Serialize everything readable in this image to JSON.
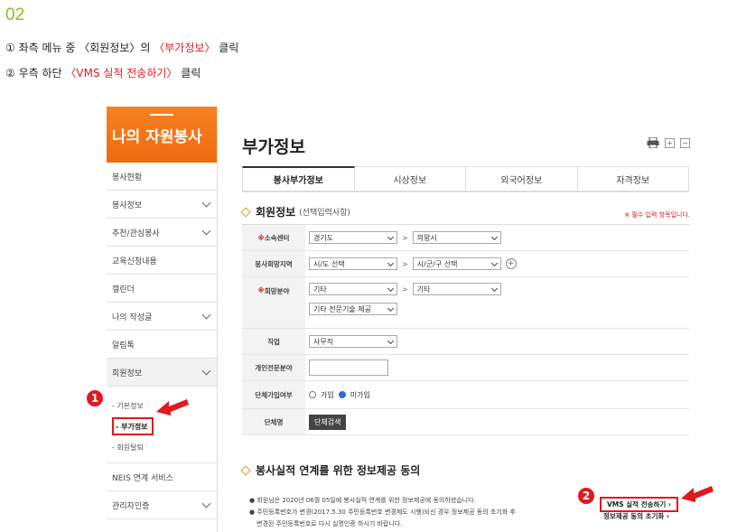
{
  "step": "02",
  "instructions": {
    "line1_pre": "① 좌측 메뉴 중 〈회원정보〉의 ",
    "line1_red": "〈부가정보〉",
    "line1_post": " 클릭",
    "line2_pre": "② 우측 하단 ",
    "line2_red": "〈VMS 실적 전송하기〉",
    "line2_post": " 클릭"
  },
  "sidebar": {
    "title": "나의 자원봉사",
    "items": [
      "봉사현황",
      "봉사정보",
      "추천/관심봉사",
      "교육신청내용",
      "캘린더",
      "나의 작성글",
      "알림톡",
      "회원정보"
    ],
    "sub_items": [
      "- 기본정보",
      "- 부가정보",
      "- 회원탈퇴"
    ],
    "bottom_items": [
      "NEIS 연계 서비스",
      "관리자인증"
    ]
  },
  "main": {
    "title": "부가정보",
    "tabs": [
      "봉사부가정보",
      "시상정보",
      "외국어정보",
      "자격정보"
    ],
    "section1": {
      "title": "회원정보",
      "subtitle": "(선택입력사항)"
    },
    "required_note": "※ 필수 입력 항목입니다.",
    "form": {
      "center_label": "소속센터",
      "center_val1": "경기도",
      "center_val2": "의왕시",
      "region_label": "봉사희망지역",
      "region_val1": "시/도 선택",
      "region_val2": "시/군/구 선택",
      "field_label": "희망분야",
      "field_val1": "기타",
      "field_val2": "기타",
      "field_val3": "기타 전문기술 제공",
      "job_label": "직업",
      "job_val": "사무직",
      "expert_label": "개인전문분야",
      "group_label": "단체가입여부",
      "group_opt1": "가입",
      "group_opt2": "미가입",
      "groupname_label": "단체명",
      "group_search_btn": "단체검색"
    },
    "section2": {
      "title": "봉사실적 연계를 위한 정보제공 동의"
    },
    "notice1": "● 회원님은 2020년 06월 05일에 봉사실적 연계를 위한 정보제공에 동의하셨습니다.",
    "notice2": "● 주민등록번호가 변경(2017.5.30 주민등록번호 변경제도 시행)되신 경우 정보제공 동의 초기화 후",
    "notice3": "변경된 주민등록번호로 다시 실명인증 하시기 바랍니다.",
    "vms_button": "VMS 실적 전송하기 ›",
    "reset_button": "정보제공 동의 초기화 ›"
  },
  "badges": [
    "1",
    "2"
  ],
  "colors": {
    "accent": "#f58220",
    "highlight": "#e0191f",
    "step": "#8cbd2a"
  }
}
